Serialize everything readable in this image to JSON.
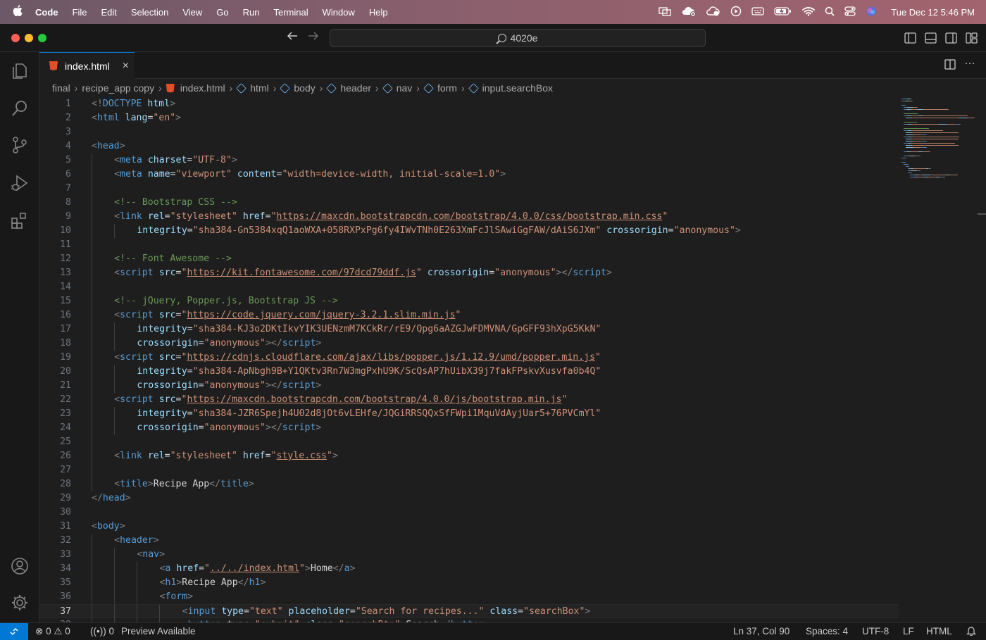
{
  "menubar": {
    "app": "Code",
    "items": [
      "File",
      "Edit",
      "Selection",
      "View",
      "Go",
      "Run",
      "Terminal",
      "Window",
      "Help"
    ],
    "clock": "Tue Dec 12  5:46 PM"
  },
  "titlebar": {
    "search": "4020e"
  },
  "tab": {
    "label": "index.html",
    "close": "×"
  },
  "breadcrumbs": [
    "final",
    "recipe_app copy",
    "index.html",
    "html",
    "body",
    "header",
    "nav",
    "form",
    "input.searchBox"
  ],
  "editor": {
    "current_line": 37,
    "lines": [
      {
        "n": "1",
        "indent": 0,
        "t": [
          [
            "tag",
            "<!"
          ],
          [
            "name",
            "DOCTYPE"
          ],
          [
            "txt",
            " "
          ],
          [
            "attr",
            "html"
          ],
          [
            "tag",
            ">"
          ]
        ]
      },
      {
        "n": "2",
        "indent": 0,
        "t": [
          [
            "tag",
            "<"
          ],
          [
            "name",
            "html"
          ],
          [
            "txt",
            " "
          ],
          [
            "attr",
            "lang"
          ],
          [
            "txt",
            "="
          ],
          [
            "str",
            "\"en\""
          ],
          [
            "tag",
            ">"
          ]
        ]
      },
      {
        "n": "3",
        "indent": 0,
        "t": []
      },
      {
        "n": "4",
        "indent": 0,
        "t": [
          [
            "tag",
            "<"
          ],
          [
            "name",
            "head"
          ],
          [
            "tag",
            ">"
          ]
        ]
      },
      {
        "n": "5",
        "indent": 1,
        "t": [
          [
            "tag",
            "<"
          ],
          [
            "name",
            "meta"
          ],
          [
            "txt",
            " "
          ],
          [
            "attr",
            "charset"
          ],
          [
            "txt",
            "="
          ],
          [
            "str",
            "\"UTF-8\""
          ],
          [
            "tag",
            ">"
          ]
        ]
      },
      {
        "n": "6",
        "indent": 1,
        "t": [
          [
            "tag",
            "<"
          ],
          [
            "name",
            "meta"
          ],
          [
            "txt",
            " "
          ],
          [
            "attr",
            "name"
          ],
          [
            "txt",
            "="
          ],
          [
            "str",
            "\"viewport\""
          ],
          [
            "txt",
            " "
          ],
          [
            "attr",
            "content"
          ],
          [
            "txt",
            "="
          ],
          [
            "str",
            "\"width=device-width, initial-scale=1.0\""
          ],
          [
            "tag",
            ">"
          ]
        ]
      },
      {
        "n": "7",
        "indent": 1,
        "t": []
      },
      {
        "n": "8",
        "indent": 1,
        "t": [
          [
            "com",
            "<!-- Bootstrap CSS -->"
          ]
        ]
      },
      {
        "n": "9",
        "indent": 1,
        "t": [
          [
            "tag",
            "<"
          ],
          [
            "name",
            "link"
          ],
          [
            "txt",
            " "
          ],
          [
            "attr",
            "rel"
          ],
          [
            "txt",
            "="
          ],
          [
            "str",
            "\"stylesheet\""
          ],
          [
            "txt",
            " "
          ],
          [
            "attr",
            "href"
          ],
          [
            "txt",
            "="
          ],
          [
            "str",
            "\""
          ],
          [
            "url",
            "https://maxcdn.bootstrapcdn.com/bootstrap/4.0.0/css/bootstrap.min.css"
          ],
          [
            "str",
            "\""
          ]
        ]
      },
      {
        "n": "10",
        "indent": 2,
        "t": [
          [
            "attr",
            "integrity"
          ],
          [
            "txt",
            "="
          ],
          [
            "str",
            "\"sha384-Gn5384xqQ1aoWXA+058RXPxPg6fy4IWvTNh0E263XmFcJlSAwiGgFAW/dAiS6JXm\""
          ],
          [
            "txt",
            " "
          ],
          [
            "attr",
            "crossorigin"
          ],
          [
            "txt",
            "="
          ],
          [
            "str",
            "\"anonymous\""
          ],
          [
            "tag",
            ">"
          ]
        ]
      },
      {
        "n": "11",
        "indent": 1,
        "t": []
      },
      {
        "n": "12",
        "indent": 1,
        "t": [
          [
            "com",
            "<!-- Font Awesome -->"
          ]
        ]
      },
      {
        "n": "13",
        "indent": 1,
        "t": [
          [
            "tag",
            "<"
          ],
          [
            "name",
            "script"
          ],
          [
            "txt",
            " "
          ],
          [
            "attr",
            "src"
          ],
          [
            "txt",
            "="
          ],
          [
            "str",
            "\""
          ],
          [
            "url",
            "https://kit.fontawesome.com/97dcd79ddf.js"
          ],
          [
            "str",
            "\""
          ],
          [
            "txt",
            " "
          ],
          [
            "attr",
            "crossorigin"
          ],
          [
            "txt",
            "="
          ],
          [
            "str",
            "\"anonymous\""
          ],
          [
            "tag",
            "></"
          ],
          [
            "name",
            "script"
          ],
          [
            "tag",
            ">"
          ]
        ]
      },
      {
        "n": "14",
        "indent": 1,
        "t": []
      },
      {
        "n": "15",
        "indent": 1,
        "t": [
          [
            "com",
            "<!-- jQuery, Popper.js, Bootstrap JS -->"
          ]
        ]
      },
      {
        "n": "16",
        "indent": 1,
        "t": [
          [
            "tag",
            "<"
          ],
          [
            "name",
            "script"
          ],
          [
            "txt",
            " "
          ],
          [
            "attr",
            "src"
          ],
          [
            "txt",
            "="
          ],
          [
            "str",
            "\""
          ],
          [
            "url",
            "https://code.jquery.com/jquery-3.2.1.slim.min.js"
          ],
          [
            "str",
            "\""
          ]
        ]
      },
      {
        "n": "17",
        "indent": 2,
        "t": [
          [
            "attr",
            "integrity"
          ],
          [
            "txt",
            "="
          ],
          [
            "str",
            "\"sha384-KJ3o2DKtIkvYIK3UENzmM7KCkRr/rE9/Qpg6aAZGJwFDMVNA/GpGFF93hXpG5KkN\""
          ]
        ]
      },
      {
        "n": "18",
        "indent": 2,
        "t": [
          [
            "attr",
            "crossorigin"
          ],
          [
            "txt",
            "="
          ],
          [
            "str",
            "\"anonymous\""
          ],
          [
            "tag",
            "></"
          ],
          [
            "name",
            "script"
          ],
          [
            "tag",
            ">"
          ]
        ]
      },
      {
        "n": "19",
        "indent": 1,
        "t": [
          [
            "tag",
            "<"
          ],
          [
            "name",
            "script"
          ],
          [
            "txt",
            " "
          ],
          [
            "attr",
            "src"
          ],
          [
            "txt",
            "="
          ],
          [
            "str",
            "\""
          ],
          [
            "url",
            "https://cdnjs.cloudflare.com/ajax/libs/popper.js/1.12.9/umd/popper.min.js"
          ],
          [
            "str",
            "\""
          ]
        ]
      },
      {
        "n": "20",
        "indent": 2,
        "t": [
          [
            "attr",
            "integrity"
          ],
          [
            "txt",
            "="
          ],
          [
            "str",
            "\"sha384-ApNbgh9B+Y1QKtv3Rn7W3mgPxhU9K/ScQsAP7hUibX39j7fakFPskvXusvfa0b4Q\""
          ]
        ]
      },
      {
        "n": "21",
        "indent": 2,
        "t": [
          [
            "attr",
            "crossorigin"
          ],
          [
            "txt",
            "="
          ],
          [
            "str",
            "\"anonymous\""
          ],
          [
            "tag",
            "></"
          ],
          [
            "name",
            "script"
          ],
          [
            "tag",
            ">"
          ]
        ]
      },
      {
        "n": "22",
        "indent": 1,
        "t": [
          [
            "tag",
            "<"
          ],
          [
            "name",
            "script"
          ],
          [
            "txt",
            " "
          ],
          [
            "attr",
            "src"
          ],
          [
            "txt",
            "="
          ],
          [
            "str",
            "\""
          ],
          [
            "url",
            "https://maxcdn.bootstrapcdn.com/bootstrap/4.0.0/js/bootstrap.min.js"
          ],
          [
            "str",
            "\""
          ]
        ]
      },
      {
        "n": "23",
        "indent": 2,
        "t": [
          [
            "attr",
            "integrity"
          ],
          [
            "txt",
            "="
          ],
          [
            "str",
            "\"sha384-JZR6Spejh4U02d8jOt6vLEHfe/JQGiRRSQQxSfFWpi1MquVdAyjUar5+76PVCmYl\""
          ]
        ]
      },
      {
        "n": "24",
        "indent": 2,
        "t": [
          [
            "attr",
            "crossorigin"
          ],
          [
            "txt",
            "="
          ],
          [
            "str",
            "\"anonymous\""
          ],
          [
            "tag",
            "></"
          ],
          [
            "name",
            "script"
          ],
          [
            "tag",
            ">"
          ]
        ]
      },
      {
        "n": "25",
        "indent": 1,
        "t": []
      },
      {
        "n": "26",
        "indent": 1,
        "t": [
          [
            "tag",
            "<"
          ],
          [
            "name",
            "link"
          ],
          [
            "txt",
            " "
          ],
          [
            "attr",
            "rel"
          ],
          [
            "txt",
            "="
          ],
          [
            "str",
            "\"stylesheet\""
          ],
          [
            "txt",
            " "
          ],
          [
            "attr",
            "href"
          ],
          [
            "txt",
            "="
          ],
          [
            "str",
            "\""
          ],
          [
            "url",
            "style.css"
          ],
          [
            "str",
            "\""
          ],
          [
            "tag",
            ">"
          ]
        ]
      },
      {
        "n": "27",
        "indent": 1,
        "t": []
      },
      {
        "n": "28",
        "indent": 1,
        "t": [
          [
            "tag",
            "<"
          ],
          [
            "name",
            "title"
          ],
          [
            "tag",
            ">"
          ],
          [
            "txt",
            "Recipe App"
          ],
          [
            "tag",
            "</"
          ],
          [
            "name",
            "title"
          ],
          [
            "tag",
            ">"
          ]
        ]
      },
      {
        "n": "29",
        "indent": 0,
        "t": [
          [
            "tag",
            "</"
          ],
          [
            "name",
            "head"
          ],
          [
            "tag",
            ">"
          ]
        ]
      },
      {
        "n": "30",
        "indent": 0,
        "t": []
      },
      {
        "n": "31",
        "indent": 0,
        "t": [
          [
            "tag",
            "<"
          ],
          [
            "name",
            "body"
          ],
          [
            "tag",
            ">"
          ]
        ]
      },
      {
        "n": "32",
        "indent": 1,
        "t": [
          [
            "tag",
            "<"
          ],
          [
            "name",
            "header"
          ],
          [
            "tag",
            ">"
          ]
        ]
      },
      {
        "n": "33",
        "indent": 2,
        "t": [
          [
            "tag",
            "<"
          ],
          [
            "name",
            "nav"
          ],
          [
            "tag",
            ">"
          ]
        ]
      },
      {
        "n": "34",
        "indent": 3,
        "t": [
          [
            "tag",
            "<"
          ],
          [
            "name",
            "a"
          ],
          [
            "txt",
            " "
          ],
          [
            "attr",
            "href"
          ],
          [
            "txt",
            "="
          ],
          [
            "str",
            "\""
          ],
          [
            "url",
            "../../index.html"
          ],
          [
            "str",
            "\""
          ],
          [
            "tag",
            ">"
          ],
          [
            "txt",
            "Home"
          ],
          [
            "tag",
            "</"
          ],
          [
            "name",
            "a"
          ],
          [
            "tag",
            ">"
          ]
        ]
      },
      {
        "n": "35",
        "indent": 3,
        "t": [
          [
            "tag",
            "<"
          ],
          [
            "name",
            "h1"
          ],
          [
            "tag",
            ">"
          ],
          [
            "txt",
            "Recipe App"
          ],
          [
            "tag",
            "</"
          ],
          [
            "name",
            "h1"
          ],
          [
            "tag",
            ">"
          ]
        ]
      },
      {
        "n": "36",
        "indent": 3,
        "t": [
          [
            "tag",
            "<"
          ],
          [
            "name",
            "form"
          ],
          [
            "tag",
            ">"
          ]
        ]
      },
      {
        "n": "37",
        "indent": 4,
        "t": [
          [
            "tag",
            "<"
          ],
          [
            "name",
            "input"
          ],
          [
            "txt",
            " "
          ],
          [
            "attr",
            "type"
          ],
          [
            "txt",
            "="
          ],
          [
            "str",
            "\"text\""
          ],
          [
            "txt",
            " "
          ],
          [
            "attr",
            "placeholder"
          ],
          [
            "txt",
            "="
          ],
          [
            "str",
            "\"Search for recipes...\""
          ],
          [
            "txt",
            " "
          ],
          [
            "attr",
            "class"
          ],
          [
            "txt",
            "="
          ],
          [
            "str",
            "\"searchBox\""
          ],
          [
            "tag",
            ">"
          ]
        ]
      },
      {
        "n": "38",
        "indent": 4,
        "t": [
          [
            "tag",
            "<"
          ],
          [
            "name",
            "button"
          ],
          [
            "txt",
            " "
          ],
          [
            "attr",
            "type"
          ],
          [
            "txt",
            "="
          ],
          [
            "str",
            "\"submit\""
          ],
          [
            "txt",
            " "
          ],
          [
            "attr",
            "class"
          ],
          [
            "txt",
            "="
          ],
          [
            "str",
            "\"searchBtn\""
          ],
          [
            "tag",
            ">"
          ],
          [
            "txt",
            "Search"
          ],
          [
            "tag",
            "</"
          ],
          [
            "name",
            "button"
          ],
          [
            "tag",
            ">"
          ]
        ]
      }
    ]
  },
  "statusbar": {
    "errors": "0",
    "warnings": "0",
    "ports": "0",
    "preview": "Preview Available",
    "position": "Ln 37, Col 90",
    "spaces": "Spaces: 4",
    "encoding": "UTF-8",
    "eol": "LF",
    "language": "HTML"
  },
  "colors": {
    "accent": "#0078d4",
    "tag": "#808080",
    "tag_name": "#569cd6",
    "attribute": "#9cdcfe",
    "string": "#ce9178",
    "comment": "#6a9955"
  }
}
